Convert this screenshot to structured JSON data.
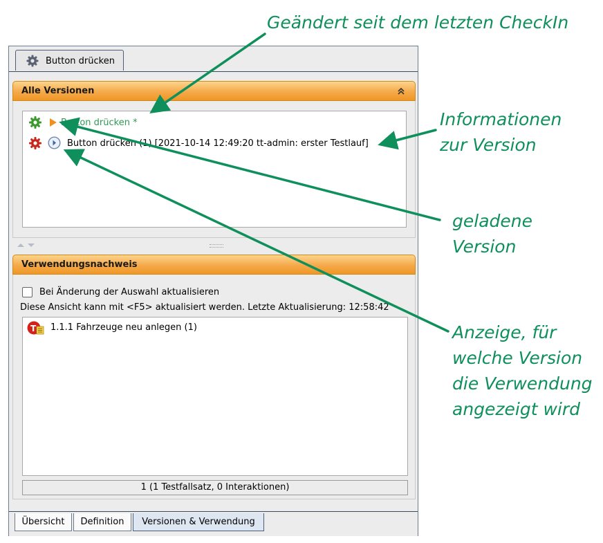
{
  "window": {
    "tab_title": "Button drücken",
    "versions_panel": {
      "title": "Alle Versionen",
      "items": [
        {
          "label": "Button drücken *"
        },
        {
          "label": "Button drücken (1) [2021-10-14 12:49:20 tt-admin: erster Testlauf]"
        }
      ]
    },
    "usage_panel": {
      "title": "Verwendungsnachweis",
      "checkbox_label": "Bei Änderung der Auswahl aktualisieren",
      "info_text": "Diese Ansicht kann mit <F5> aktualisiert werden. Letzte Aktualisierung: 12:58:42",
      "items": [
        {
          "label": "1.1.1 Fahrzeuge neu anlegen (1)"
        }
      ],
      "status": "1 (1 Testfallsatz, 0 Interaktionen)"
    },
    "bottom_tabs": [
      {
        "label": "Übersicht"
      },
      {
        "label": "Definition"
      },
      {
        "label": "Versionen & Verwendung"
      }
    ]
  },
  "annotations": {
    "changed": "Geändert seit dem letzten CheckIn",
    "info_1": "Informationen",
    "info_2": "zur Version",
    "loaded_1": "geladene",
    "loaded_2": "Version",
    "usage_1": "Anzeige, für",
    "usage_2": "welche Version",
    "usage_3": "die Verwendung",
    "usage_4": "angezeigt wird"
  },
  "colors": {
    "annotation": "#0e8f5b",
    "header_orange": "#f5a94a",
    "changed_text": "#2e9a55"
  }
}
